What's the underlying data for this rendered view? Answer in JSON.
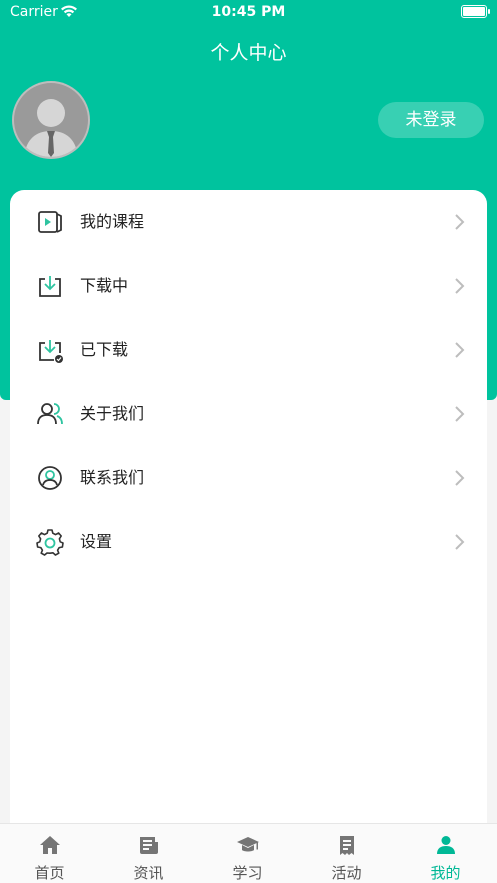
{
  "status_bar": {
    "carrier": "Carrier",
    "time": "10:45 PM"
  },
  "header": {
    "title": "个人中心",
    "login_label": "未登录"
  },
  "colors": {
    "accent": "#00c39e",
    "active_tab": "#00b896",
    "icon_accent": "#2ec4a0",
    "icon_dark": "#333333"
  },
  "menu": [
    {
      "label": "我的课程",
      "icon": "play-video-icon"
    },
    {
      "label": "下载中",
      "icon": "download-icon"
    },
    {
      "label": "已下载",
      "icon": "downloaded-icon"
    },
    {
      "label": "关于我们",
      "icon": "users-icon"
    },
    {
      "label": "联系我们",
      "icon": "contact-icon"
    },
    {
      "label": "设置",
      "icon": "gear-icon"
    }
  ],
  "tabs": [
    {
      "label": "首页",
      "icon": "home-icon",
      "active": false
    },
    {
      "label": "资讯",
      "icon": "news-icon",
      "active": false
    },
    {
      "label": "学习",
      "icon": "graduation-cap-icon",
      "active": false
    },
    {
      "label": "活动",
      "icon": "receipt-icon",
      "active": false
    },
    {
      "label": "我的",
      "icon": "person-icon",
      "active": true
    }
  ]
}
